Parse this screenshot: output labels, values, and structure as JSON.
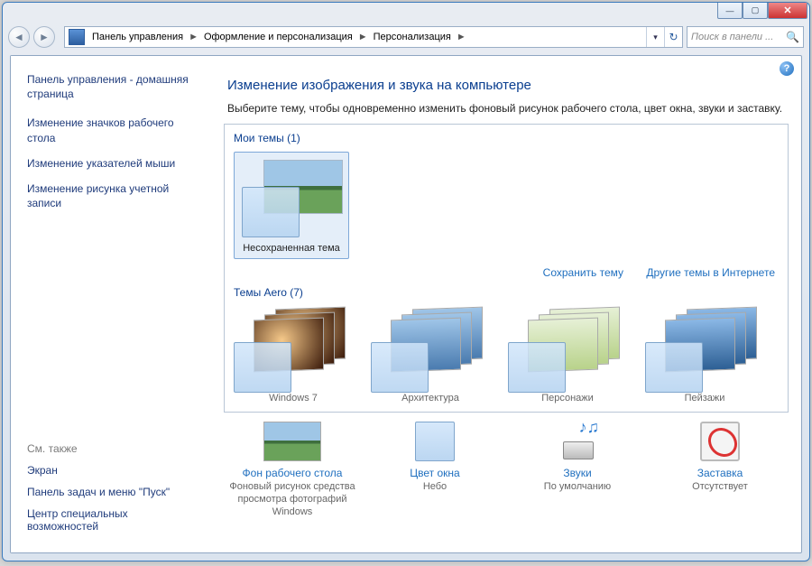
{
  "breadcrumb": {
    "items": [
      "Панель управления",
      "Оформление и персонализация",
      "Персонализация"
    ]
  },
  "search": {
    "placeholder": "Поиск в панели ..."
  },
  "sidebar": {
    "home": "Панель управления - домашняя страница",
    "links": [
      "Изменение значков рабочего стола",
      "Изменение указателей мыши",
      "Изменение рисунка учетной записи"
    ],
    "see_also_label": "См. также",
    "see_also": [
      "Экран",
      "Панель задач и меню \"Пуск\"",
      "Центр специальных возможностей"
    ]
  },
  "page": {
    "title": "Изменение изображения и звука на компьютере",
    "desc": "Выберите тему, чтобы одновременно изменить фоновый рисунок рабочего стола, цвет окна, звуки и заставку."
  },
  "groups": {
    "my_themes_label": "Мои темы (1)",
    "my_themes": [
      {
        "caption": "Несохраненная тема"
      }
    ],
    "actions": {
      "save": "Сохранить тему",
      "online": "Другие темы в Интернете"
    },
    "aero_label": "Темы Aero (7)",
    "aero": [
      {
        "caption": "Windows 7"
      },
      {
        "caption": "Архитектура"
      },
      {
        "caption": "Персонажи"
      },
      {
        "caption": "Пейзажи"
      }
    ]
  },
  "bottom": {
    "wallpaper": {
      "link": "Фон рабочего стола",
      "sub": "Фоновый рисунок средства просмотра фотографий Windows"
    },
    "color": {
      "link": "Цвет окна",
      "sub": "Небо"
    },
    "sounds": {
      "link": "Звуки",
      "sub": "По умолчанию"
    },
    "saver": {
      "link": "Заставка",
      "sub": "Отсутствует"
    }
  },
  "help_glyph": "?"
}
